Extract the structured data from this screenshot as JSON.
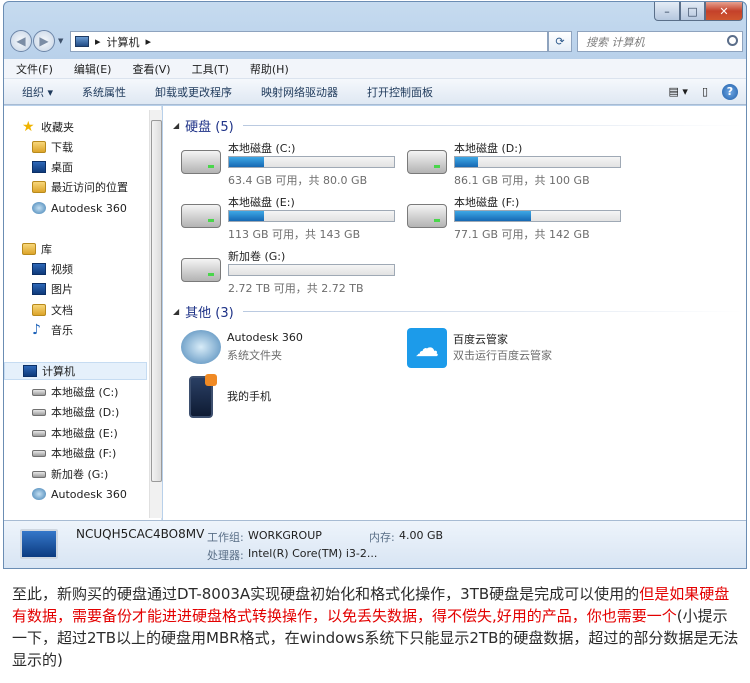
{
  "window": {
    "controls": {
      "minimize": "–",
      "maximize": "□",
      "close": "✕"
    }
  },
  "address": {
    "path": "计算机",
    "separator": "▸",
    "search_placeholder": "搜索 计算机"
  },
  "menubar": [
    "文件(F)",
    "编辑(E)",
    "查看(V)",
    "工具(T)",
    "帮助(H)"
  ],
  "toolbar": [
    "组织 ▾",
    "系统属性",
    "卸载或更改程序",
    "映射网络驱动器",
    "打开控制面板"
  ],
  "nav": {
    "favorites": {
      "label": "收藏夹",
      "items": [
        "下载",
        "桌面",
        "最近访问的位置",
        "Autodesk 360"
      ]
    },
    "libraries": {
      "label": "库",
      "items": [
        "视频",
        "图片",
        "文档",
        "音乐"
      ]
    },
    "computer": {
      "label": "计算机",
      "items": [
        "本地磁盘 (C:)",
        "本地磁盘 (D:)",
        "本地磁盘 (E:)",
        "本地磁盘 (F:)",
        "新加卷 (G:)",
        "Autodesk 360"
      ]
    }
  },
  "sections": {
    "drives_header": "硬盘 (5)",
    "other_header": "其他 (3)"
  },
  "drives": [
    {
      "name": "本地磁盘 (C:)",
      "info": "63.4 GB 可用，共 80.0 GB",
      "used_fraction": 0.21
    },
    {
      "name": "本地磁盘 (D:)",
      "info": "86.1 GB 可用，共 100 GB",
      "used_fraction": 0.14
    },
    {
      "name": "本地磁盘 (E:)",
      "info": "113 GB 可用，共 143 GB",
      "used_fraction": 0.21
    },
    {
      "name": "本地磁盘 (F:)",
      "info": "77.1 GB 可用，共 142 GB",
      "used_fraction": 0.46
    },
    {
      "name": "新加卷 (G:)",
      "info": "2.72 TB 可用，共 2.72 TB",
      "used_fraction": 0.0
    }
  ],
  "others": [
    {
      "name": "Autodesk 360",
      "desc": "系统文件夹"
    },
    {
      "name": "百度云管家",
      "desc": "双击运行百度云管家"
    },
    {
      "name": "我的手机",
      "desc": ""
    }
  ],
  "details": {
    "pc_name": "NCUQH5CAC4BO8MV",
    "workgroup_label": "工作组:",
    "workgroup": "WORKGROUP",
    "memory_label": "内存:",
    "memory": "4.00 GB",
    "cpu_label": "处理器:",
    "cpu": "Intel(R) Core(TM) i3-2..."
  },
  "caption": {
    "part1": "至此，新购买的硬盘通过DT-8003A实现硬盘初始化和格式化操作，3TB硬盘是完成可以使用的",
    "part2_red": "但是如果硬盘有数据，需要备份才能进进硬盘格式转换操作，以免丢失数据，得不偿失,好用的产品，你也需要一个",
    "part3": "(小提示一下，超过2TB以上的硬盘用MBR格式，在windows系统下只能显示2TB的硬盘数据，超过的部分数据是无法显示的)"
  },
  "colors": {
    "bar_fill": "#1e7fcf",
    "accent_red": "#e30000",
    "section_blue": "#1e3287"
  }
}
